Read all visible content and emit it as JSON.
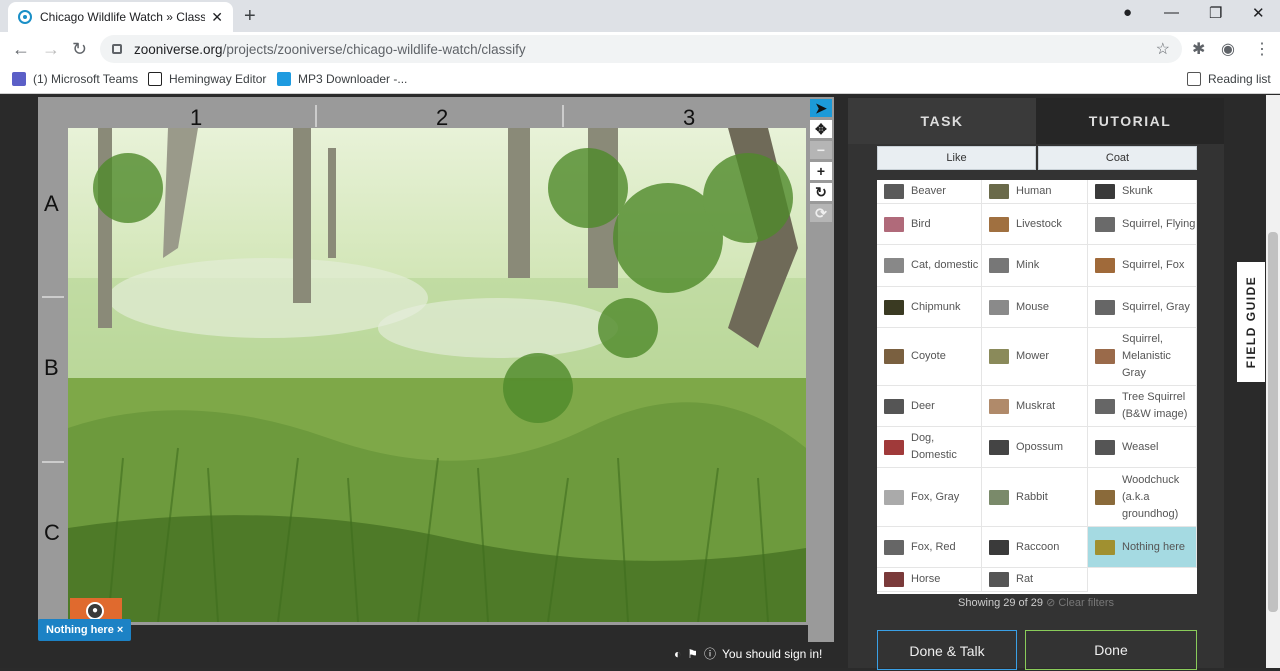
{
  "browser": {
    "tab_title": "Chicago Wildlife Watch » Classify",
    "tab_close": "✕",
    "new_tab": "+",
    "url_host": "zooniverse.org",
    "url_path": "/projects/zooniverse/chicago-wildlife-watch/classify",
    "bookmarks": [
      "(1) Microsoft Teams",
      "Hemingway Editor",
      "MP3 Downloader -..."
    ],
    "reading_list": "Reading list"
  },
  "subject": {
    "columns": [
      "1",
      "2",
      "3"
    ],
    "rows": [
      "A",
      "B",
      "C"
    ],
    "nothing_badge": "Nothing here ×",
    "sign_in": "You should sign in!"
  },
  "panel": {
    "tabs": {
      "task": "TASK",
      "tutorial": "TUTORIAL"
    },
    "filters": {
      "like": "Like",
      "coat": "Coat"
    },
    "species": [
      {
        "name": "Beaver",
        "color": "#5a5a5a"
      },
      {
        "name": "Human",
        "color": "#6a6a4a"
      },
      {
        "name": "Skunk",
        "color": "#3a3a3a"
      },
      {
        "name": "Bird",
        "color": "#b06a7a"
      },
      {
        "name": "Livestock",
        "color": "#a07040"
      },
      {
        "name": "Squirrel, Flying",
        "color": "#6a6a6a"
      },
      {
        "name": "Cat, domestic",
        "color": "#888"
      },
      {
        "name": "Mink",
        "color": "#777"
      },
      {
        "name": "Squirrel, Fox",
        "color": "#a06a3a"
      },
      {
        "name": "Chipmunk",
        "color": "#3a3a22"
      },
      {
        "name": "Mouse",
        "color": "#8a8a8a"
      },
      {
        "name": "Squirrel, Gray",
        "color": "#666"
      },
      {
        "name": "Coyote",
        "color": "#7a6040"
      },
      {
        "name": "Mower",
        "color": "#8a8a5a"
      },
      {
        "name": "Squirrel, Melanistic Gray",
        "color": "#9a6a4a"
      },
      {
        "name": "Deer",
        "color": "#555"
      },
      {
        "name": "Muskrat",
        "color": "#b08a6a"
      },
      {
        "name": "Tree Squirrel (B&W image)",
        "color": "#666"
      },
      {
        "name": "Dog, Domestic",
        "color": "#a03a3a"
      },
      {
        "name": "Opossum",
        "color": "#444"
      },
      {
        "name": "Weasel",
        "color": "#555"
      },
      {
        "name": "Fox, Gray",
        "color": "#aaa"
      },
      {
        "name": "Rabbit",
        "color": "#7a8a6a"
      },
      {
        "name": "Woodchuck (a.k.a groundhog)",
        "color": "#8a6a3a"
      },
      {
        "name": "Fox, Red",
        "color": "#666"
      },
      {
        "name": "Raccoon",
        "color": "#3a3a3a"
      },
      {
        "name": "Nothing here",
        "color": "#a09030",
        "selected": true
      },
      {
        "name": "Horse",
        "color": "#7a3a3a"
      },
      {
        "name": "Rat",
        "color": "#555"
      }
    ],
    "showing": "Showing 29 of 29",
    "clear_filters": "Clear filters",
    "done_talk": "Done & Talk",
    "done": "Done",
    "field_guide": "FIELD GUIDE"
  },
  "colors": {
    "accent_blue": "#1c9ad8",
    "selected": "#a5dae2",
    "done_border": "#8acc5a",
    "talk_border": "#3aa0e6"
  }
}
